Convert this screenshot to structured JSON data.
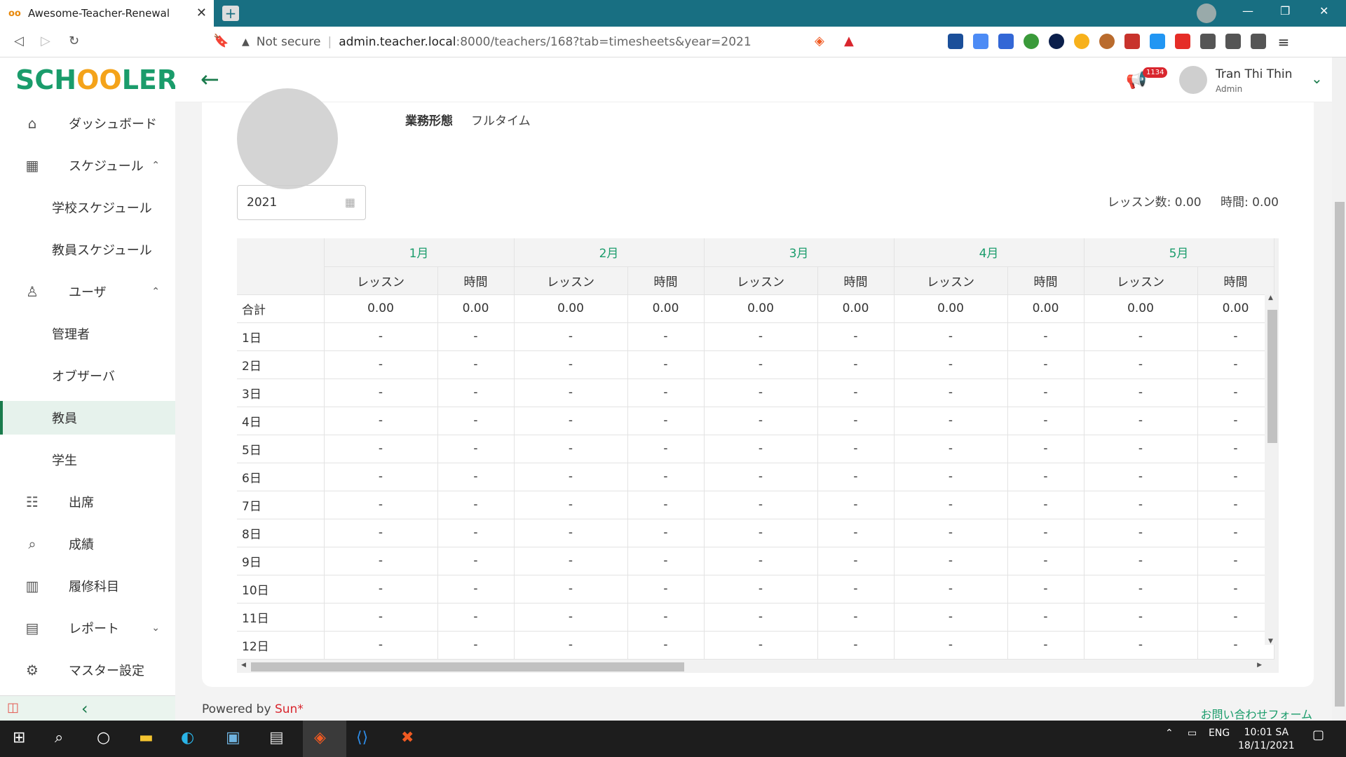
{
  "browser": {
    "tab_title": "Awesome-Teacher-Renewal",
    "tab_favicon": "oo",
    "not_secure": "Not secure",
    "url_host": "admin.teacher.local",
    "url_path": ":8000/teachers/168?tab=timesheets&year=2021"
  },
  "logo": {
    "left": "SCH",
    "o1": "O",
    "o2": "O",
    "right": "LER"
  },
  "sidebar": {
    "items": [
      {
        "label": "ダッシュボード",
        "icon": "home-icon"
      },
      {
        "label": "スケジュール",
        "icon": "calendar-icon",
        "chevron": "^"
      },
      {
        "label": "学校スケジュール"
      },
      {
        "label": "教員スケジュール"
      },
      {
        "label": "ユーザ",
        "icon": "user-icon",
        "chevron": "^"
      },
      {
        "label": "管理者"
      },
      {
        "label": "オブザーバ"
      },
      {
        "label": "教員"
      },
      {
        "label": "学生"
      },
      {
        "label": "出席",
        "icon": "attendance-icon"
      },
      {
        "label": "成績",
        "icon": "grades-icon"
      },
      {
        "label": "履修科目",
        "icon": "book-icon"
      },
      {
        "label": "レポート",
        "icon": "report-icon",
        "chevron": "v"
      },
      {
        "label": "マスター設定",
        "icon": "gear-icon"
      }
    ]
  },
  "header": {
    "notification_count": "1134",
    "user_name": "Tran Thi Thin",
    "user_role": "Admin"
  },
  "profile": {
    "employment_label": "業務形態",
    "employment_value": "フルタイム"
  },
  "year_picker": {
    "value": "2021"
  },
  "summary": {
    "lessons": "レッスン数:  0.00",
    "hours": "時間:  0.00"
  },
  "timesheet": {
    "months": [
      "1月",
      "2月",
      "3月",
      "4月",
      "5月"
    ],
    "col_lesson": "レッスン",
    "col_hours": "時間",
    "total_label": "合計",
    "total_values": [
      "0.00",
      "0.00",
      "0.00",
      "0.00",
      "0.00",
      "0.00",
      "0.00",
      "0.00",
      "0.00",
      "0.00"
    ],
    "days": [
      "1日",
      "2日",
      "3日",
      "4日",
      "5日",
      "6日",
      "7日",
      "8日",
      "9日",
      "10日",
      "11日",
      "12日"
    ],
    "empty": "-"
  },
  "footer": {
    "powered_by": "Powered by ",
    "brand": "Sun*",
    "contact": "お問い合わせフォーム"
  },
  "taskbar": {
    "lang": "ENG",
    "time": "10:01 SA",
    "date": "18/11/2021"
  }
}
